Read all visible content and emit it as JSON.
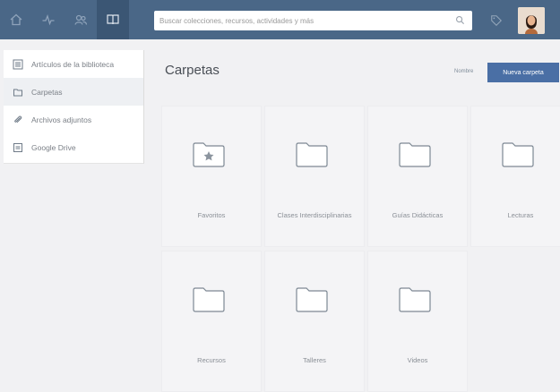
{
  "topbar": {
    "nav_icons": [
      "home-icon",
      "activity-icon",
      "group-icon",
      "library-icon"
    ],
    "search_placeholder": "Buscar colecciones, recursos, actividades y más",
    "avatar_alt": "Foto de perfil"
  },
  "sidebar": {
    "items": [
      {
        "label": "Artículos de la biblioteca",
        "icon": "articles-icon"
      },
      {
        "label": "Carpetas",
        "icon": "folder-icon"
      },
      {
        "label": "Archivos adjuntos",
        "icon": "paperclip-icon"
      },
      {
        "label": "Google Drive",
        "icon": "google-drive-icon"
      }
    ]
  },
  "main": {
    "title": "Carpetas",
    "sort_label": "Nombre",
    "new_folder_label": "Nueva carpeta",
    "folders": [
      {
        "name": "Favoritos",
        "icon": "starred-folder-icon"
      },
      {
        "name": "Clases Interdisciplinarias",
        "icon": "folder-icon"
      },
      {
        "name": "Guías Didácticas",
        "icon": "folder-icon"
      },
      {
        "name": "Lecturas",
        "icon": "folder-icon"
      },
      {
        "name": "Recursos",
        "icon": "folder-icon"
      },
      {
        "name": "Talleres",
        "icon": "folder-icon"
      },
      {
        "name": "Videos",
        "icon": "folder-icon"
      }
    ]
  },
  "colors": {
    "topbar": "#4a6787",
    "accent": "#4a6fa5"
  }
}
